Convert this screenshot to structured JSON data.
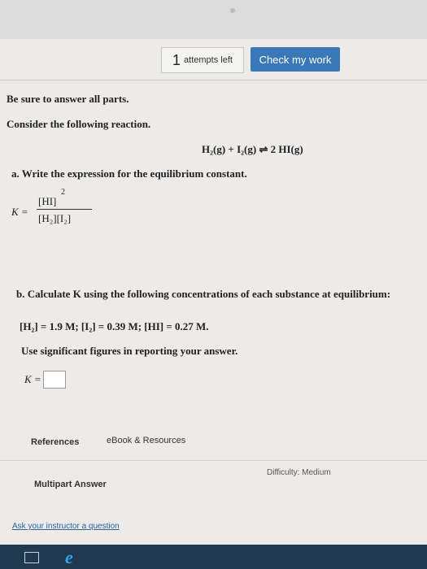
{
  "header": {
    "attempts_number": "1",
    "attempts_label": "attempts left",
    "check_button": "Check my work"
  },
  "question": {
    "instruction": "Be sure to answer all parts.",
    "prompt": "Consider the following reaction.",
    "reaction": "H₂(g) + I₂(g) ⇌ 2 HI(g)",
    "part_a": "a. Write the expression for the equilibrium constant.",
    "k_expression": {
      "label": "K =",
      "numerator": "[HI]",
      "exponent": "2",
      "denominator": "[H₂][I₂]"
    },
    "part_b": "b. Calculate K using the following concentrations of each substance at equilibrium:",
    "concentrations": "[H₂] = 1.9 M; [I₂] = 0.39 M;    [HI] = 0.27 M.",
    "sig_figs": "Use significant figures in reporting your answer.",
    "k_input_label": "K =",
    "k_input_value": ""
  },
  "footer": {
    "references": "References",
    "ebook": "eBook & Resources",
    "multipart": "Multipart Answer",
    "difficulty": "Difficulty: Medium",
    "ask": "Ask your instructor a question"
  },
  "taskbar": {
    "icons": [
      "task-view-icon",
      "edge-browser-icon"
    ]
  }
}
